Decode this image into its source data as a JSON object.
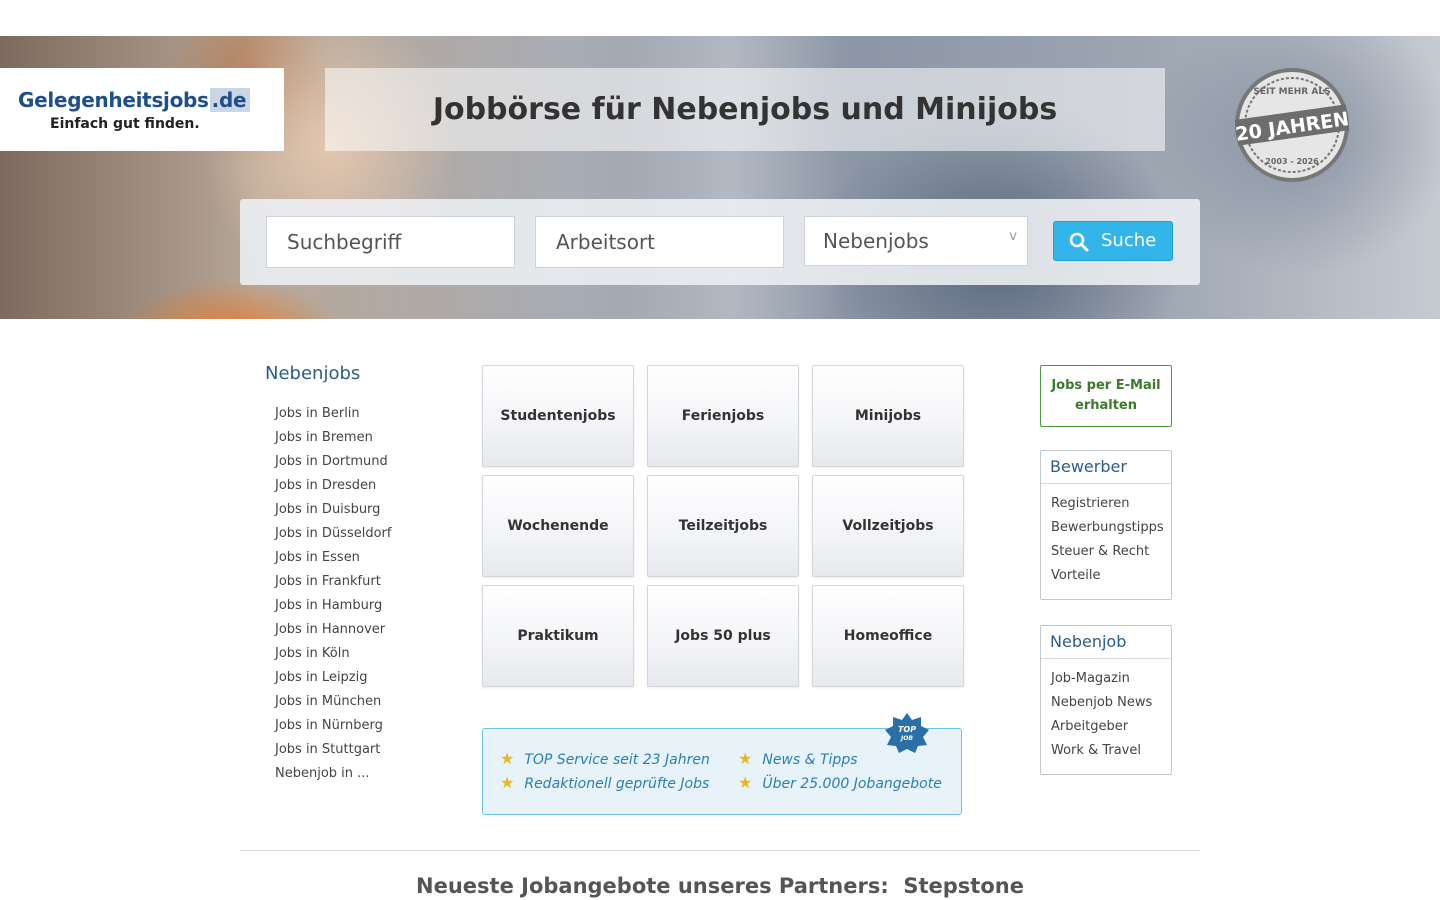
{
  "header": {
    "logo_main": "Gelegenheitsjobs",
    "logo_tld": ".de",
    "logo_tagline": "Einfach gut finden.",
    "headline": "Jobbörse für Nebenjobs und Minijobs",
    "badge": {
      "top_text": "SEIT MEHR ALS",
      "main_text": "20 JAHREN",
      "bottom_text": "2003 - 2026"
    }
  },
  "search": {
    "keyword_placeholder": "Suchbegriff",
    "location_placeholder": "Arbeitsort",
    "category_selected": "Nebenjobs",
    "button_label": "Suche",
    "button_color": "#33b5ea"
  },
  "left_nav": {
    "title": "Nebenjobs",
    "items": [
      "Jobs in Berlin",
      "Jobs in Bremen",
      "Jobs in Dortmund",
      "Jobs in Dresden",
      "Jobs in Duisburg",
      "Jobs in Düsseldorf",
      "Jobs in Essen",
      "Jobs in Frankfurt",
      "Jobs in Hamburg",
      "Jobs in Hannover",
      "Jobs in Köln",
      "Jobs in Leipzig",
      "Jobs in München",
      "Jobs in Nürnberg",
      "Jobs in Stuttgart",
      "Nebenjob in ..."
    ]
  },
  "categories": [
    "Studentenjobs",
    "Ferienjobs",
    "Minijobs",
    "Wochenende",
    "Teilzeitjobs",
    "Vollzeitjobs",
    "Praktikum",
    "Jobs 50 plus",
    "Homeoffice"
  ],
  "promo": {
    "badge_text_1": "TOP",
    "badge_text_2": "JOB",
    "items": [
      "TOP Service seit 23 Jahren",
      "News & Tipps",
      "Redaktionell geprüfte Jobs",
      "Über 25.000 Jobangebote"
    ]
  },
  "sidebar": {
    "email_label": "Jobs per E-Mail erhalten",
    "bewerber": {
      "title": "Bewerber",
      "items": [
        "Registrieren",
        "Bewerbungstipps",
        "Steuer & Recht",
        "Vorteile"
      ]
    },
    "nebenjob": {
      "title": "Nebenjob",
      "items": [
        "Job-Magazin",
        "Nebenjob News",
        "Arbeitgeber",
        "Work & Travel"
      ]
    }
  },
  "partner": {
    "title": "Neueste Jobangebote unseres Partners:  Stepstone"
  }
}
